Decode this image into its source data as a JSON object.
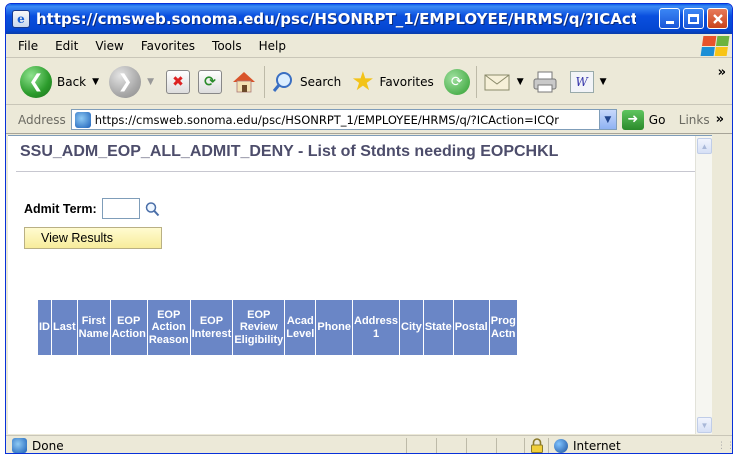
{
  "window": {
    "title": "https://cmsweb.sonoma.edu/psc/HSONRPT_1/EMPLOYEE/HRMS/q/?ICAction=ICQr...",
    "app_icon": "ie-page-icon"
  },
  "menu": {
    "items": [
      "File",
      "Edit",
      "View",
      "Favorites",
      "Tools",
      "Help"
    ]
  },
  "toolbar": {
    "back_label": "Back",
    "search_label": "Search",
    "favorites_label": "Favorites",
    "overflow": "»"
  },
  "address": {
    "label": "Address",
    "url": "https://cmsweb.sonoma.edu/psc/HSONRPT_1/EMPLOYEE/HRMS/q/?ICAction=ICQr",
    "go_label": "Go",
    "links_label": "Links",
    "links_overflow": "»"
  },
  "page": {
    "title": "SSU_ADM_EOP_ALL_ADMIT_DENY - List of Stdnts needing EOPCHKL",
    "admit_term_label": "Admit Term:",
    "admit_term_value": "",
    "view_results_label": "View Results"
  },
  "table": {
    "columns": [
      "ID",
      "Last",
      "First Name",
      "EOP Action",
      "EOP Action Reason",
      "EOP Interest",
      "EOP Review Eligibility",
      "Acad Level",
      "Phone",
      "Address 1",
      "City",
      "State",
      "Postal",
      "Prog Actn"
    ],
    "column_lines": [
      [
        "ID"
      ],
      [
        "Last"
      ],
      [
        "First",
        "Name"
      ],
      [
        "EOP",
        "Action"
      ],
      [
        "EOP",
        "Action",
        "Reason"
      ],
      [
        "EOP",
        "Interest"
      ],
      [
        "EOP",
        "Review",
        "Eligibility"
      ],
      [
        "Acad",
        "Level"
      ],
      [
        "Phone"
      ],
      [
        "Address",
        "1"
      ],
      [
        "City"
      ],
      [
        "State"
      ],
      [
        "Postal"
      ],
      [
        "Prog",
        "Actn"
      ]
    ]
  },
  "status": {
    "text": "Done",
    "zone": "Internet"
  },
  "colors": {
    "table_header": "#6a86c6",
    "button_bg": "#f7ec9b",
    "title_text": "#4d4d6b",
    "titlebar": "#0446d0"
  }
}
